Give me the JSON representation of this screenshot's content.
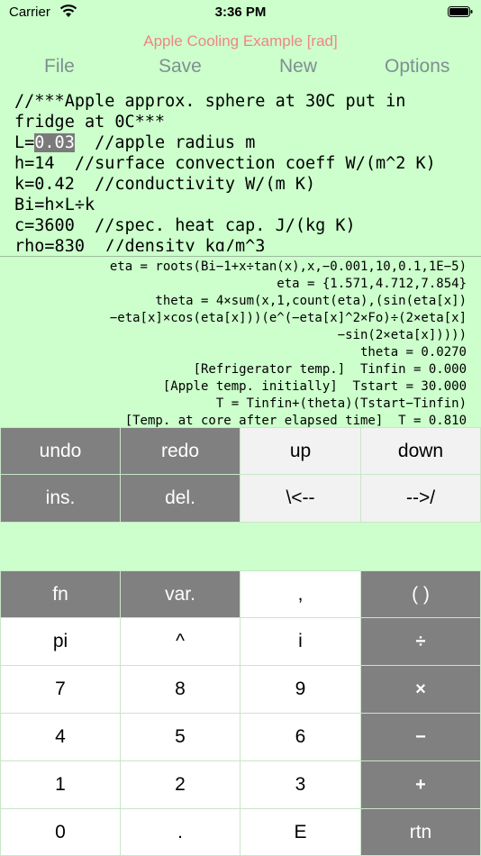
{
  "status": {
    "carrier": "Carrier",
    "time": "3:36 PM"
  },
  "title": "Apple Cooling Example [rad]",
  "menu": {
    "file": "File",
    "save": "Save",
    "new": "New",
    "options": "Options"
  },
  "editor": {
    "line1": "//***Apple approx. sphere at 30C put in",
    "line2": "fridge at 0C***",
    "line3_prefix": "L=",
    "line3_selected": "0.03",
    "line3_suffix": "  //apple radius m",
    "line4": "h=14  //surface convection coeff W/(m^2 K)",
    "line5": "k=0.42  //conductivity W/(m K)",
    "line6": "Bi=h×L÷k",
    "line7": "c=3600  //spec. heat cap. J/(kg K)",
    "line8": "rho=830  //density kg/m^3"
  },
  "output": {
    "line1": "eta = roots(Bi−1+x÷tan(x),x,−0.001,10,0.1,1E−5)",
    "line2": "eta = {1.571,4.712,7.854}",
    "line3": "theta = 4×sum(x,1,count(eta),(sin(eta[x])",
    "line4": "−eta[x]×cos(eta[x]))(e^(−eta[x]^2×Fo)÷(2×eta[x]",
    "line5": "−sin(2×eta[x]))))",
    "line6": "theta = 0.0270",
    "line7": "[Refrigerator temp.]  Tinfin = 0.000",
    "line8": "[Apple temp. initially]  Tstart = 30.000",
    "line9": "T = Tinfin+(theta)(Tstart−Tinfin)",
    "line10": "[Temp. at core after elapsed time]  T = 0.810"
  },
  "edit_keys": {
    "undo": "undo",
    "redo": "redo",
    "up": "up",
    "down": "down",
    "ins": "ins.",
    "del": "del.",
    "left": "\\<--",
    "right": "-->/"
  },
  "keypad": {
    "fn": "fn",
    "var": "var.",
    "comma": ",",
    "parens": "( )",
    "pi": "pi",
    "caret": "^",
    "i": "i",
    "divide": "÷",
    "seven": "7",
    "eight": "8",
    "nine": "9",
    "multiply": "×",
    "four": "4",
    "five": "5",
    "six": "6",
    "minus": "−",
    "one": "1",
    "two": "2",
    "three": "3",
    "plus": "+",
    "zero": "0",
    "dot": ".",
    "exp": "E",
    "rtn": "rtn"
  }
}
